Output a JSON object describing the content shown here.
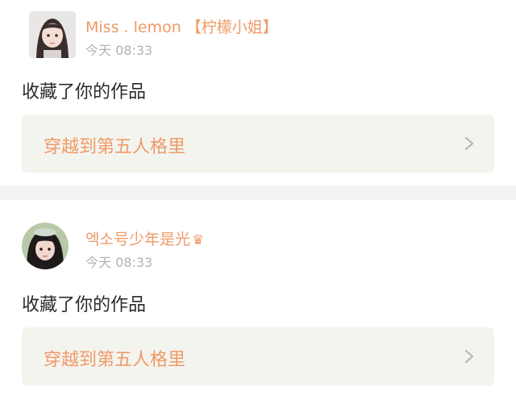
{
  "notifications": [
    {
      "username": "Miss . lemon 【柠檬小姐】",
      "crown": "",
      "time": "今天 08:33",
      "action": "收藏了你的作品",
      "work_title": "穿越到第五人格里"
    },
    {
      "username": "엑소号少年是光",
      "crown": "♛",
      "time": "今天 08:33",
      "action": "收藏了你的作品",
      "work_title": "穿越到第五人格里"
    }
  ],
  "colors": {
    "accent": "#ef9a66",
    "time": "#b3b3b3",
    "card_bg": "#f4f4ef",
    "divider": "#f2f2f2"
  },
  "icons": {
    "chevron": "chevron-right-icon"
  }
}
